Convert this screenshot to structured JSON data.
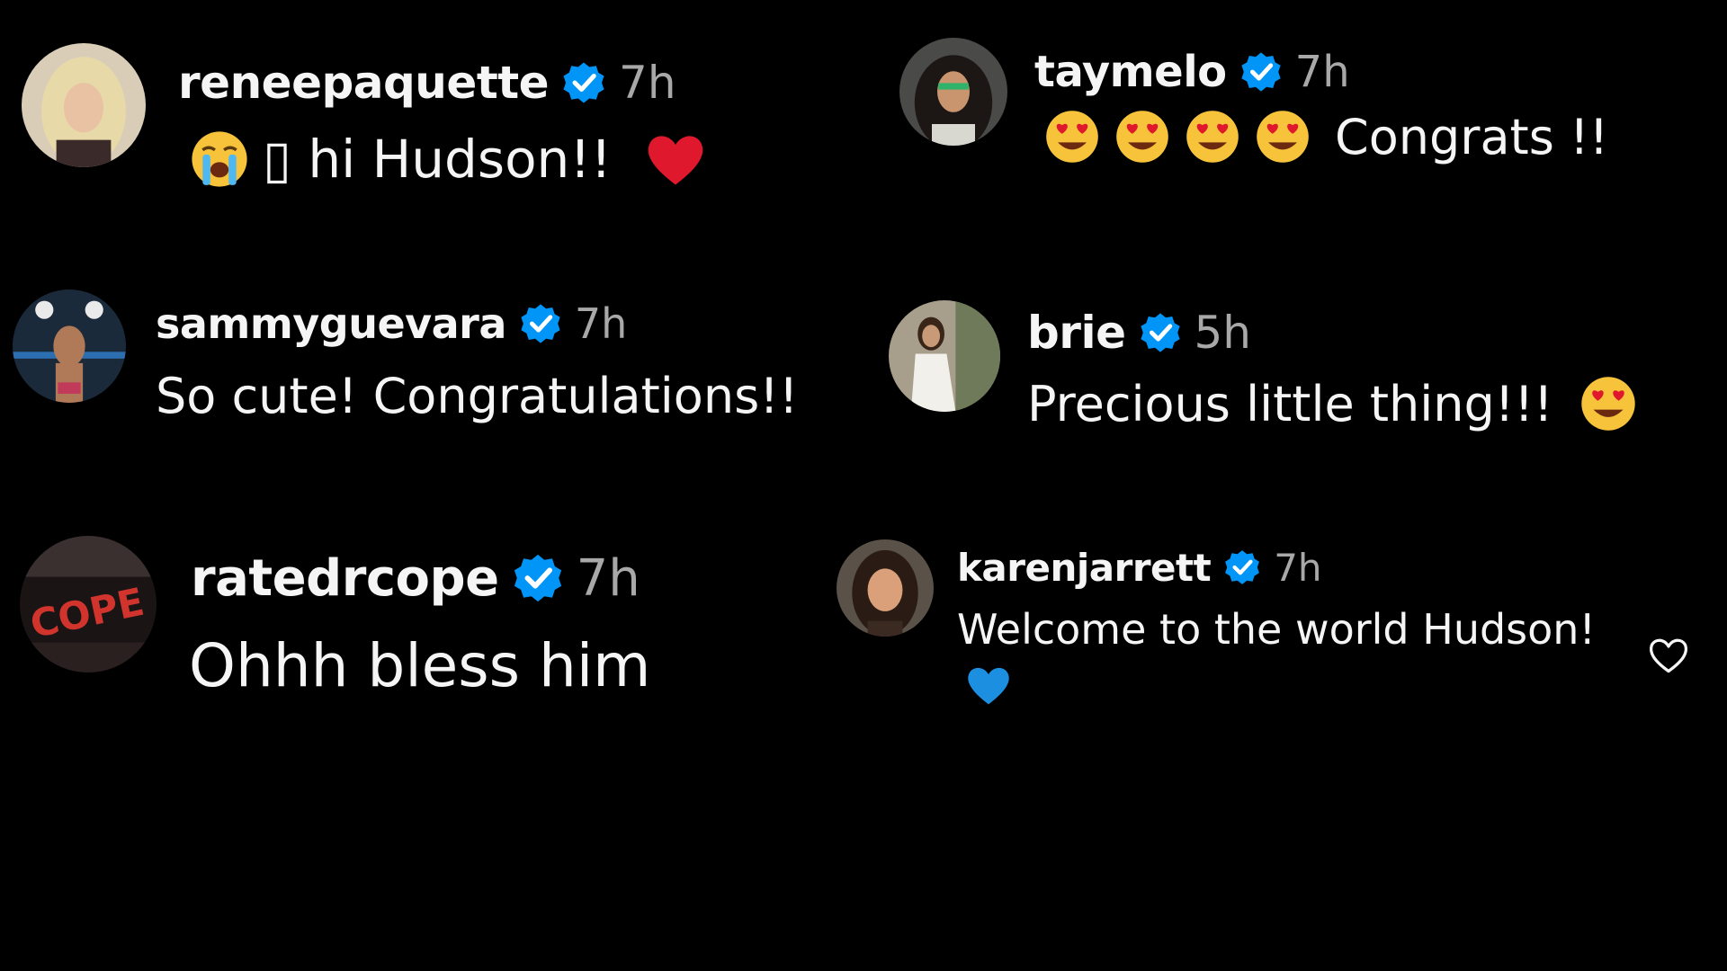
{
  "comments": [
    {
      "username": "reneepaquette",
      "time": "7h",
      "text": "▯ hi Hudson!!",
      "icons": [
        "loudly-crying-face-emoji",
        "red-heart-emoji"
      ]
    },
    {
      "username": "taymelo",
      "time": "7h",
      "text": "Congrats !!",
      "icons": [
        "heart-eyes-emoji"
      ]
    },
    {
      "username": "sammyguevara",
      "time": "7h",
      "text": "So cute! Congratulations!!"
    },
    {
      "username": "brie",
      "time": "5h",
      "text": "Precious little thing!!!",
      "icons": [
        "heart-eyes-emoji"
      ]
    },
    {
      "username": "ratedrcope",
      "time": "7h",
      "text": "Ohhh bless him"
    },
    {
      "username": "karenjarrett",
      "time": "7h",
      "text": "Welcome to the world Hudson!",
      "icons": [
        "blue-heart-emoji"
      ]
    }
  ],
  "colors": {
    "background": "#000000",
    "text": "#f5f5f5",
    "muted": "#a8a8a8",
    "verified": "#0095f6",
    "red_heart": "#e0182d",
    "blue_heart": "#1d8fe1",
    "emoji_yellow": "#f7c33a"
  },
  "icons": {
    "verified": "verified-badge-icon",
    "like": "heart-outline-icon"
  }
}
